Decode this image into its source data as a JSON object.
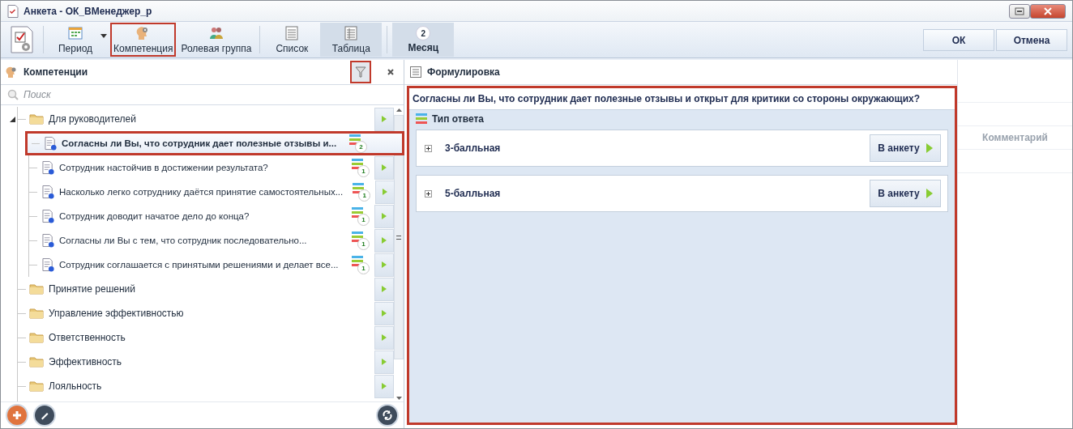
{
  "window": {
    "title": "Анкета - ОК_ВМенеджер_р"
  },
  "toolbar": {
    "items": [
      {
        "kind": "app"
      },
      {
        "kind": "dropdown",
        "label": "Период",
        "pressed": false,
        "highlighted": false
      },
      {
        "kind": "button",
        "label": "Компетенция",
        "pressed": false,
        "highlighted": true
      },
      {
        "kind": "button",
        "label": "Ролевая группа",
        "pressed": false,
        "highlighted": false
      },
      {
        "kind": "button",
        "label": "Список",
        "pressed": false,
        "highlighted": false
      },
      {
        "kind": "button",
        "label": "Таблица",
        "pressed": true,
        "highlighted": false
      },
      {
        "kind": "badge",
        "label": "Месяц",
        "badge": "2",
        "pressed": true,
        "highlighted": false
      }
    ],
    "buttons": [
      "ОК",
      "Отмена"
    ]
  },
  "left_panel": {
    "title": "Компетенции",
    "filter_highlighted": true,
    "search": {
      "placeholder": "Поиск"
    },
    "tree": [
      {
        "label": "Для руководителей",
        "children": [
          {
            "label": "Согласны ли Вы, что сотрудник дает полезные отзывы и...",
            "count": "2",
            "selected": true,
            "highlighted": true
          },
          {
            "label": "Сотрудник настойчив в достижении результата?",
            "count": "1",
            "selected": false,
            "highlighted": false
          },
          {
            "label": "Насколько легко сотруднику даётся принятие самостоятельных...",
            "count": "1",
            "selected": false,
            "highlighted": false
          },
          {
            "label": "Сотрудник доводит начатое дело до конца?",
            "count": "1",
            "selected": false,
            "highlighted": false
          },
          {
            "label": "Согласны ли Вы с тем, что сотрудник последовательно...",
            "count": "1",
            "selected": false,
            "highlighted": false
          },
          {
            "label": "Сотрудник соглашается с принятыми решениями и делает все...",
            "count": "1",
            "selected": false,
            "highlighted": false
          }
        ]
      },
      {
        "label": "Принятие решений"
      },
      {
        "label": "Управление эффективностью"
      },
      {
        "label": "Ответственность"
      },
      {
        "label": "Эффективность"
      },
      {
        "label": "Лояльность"
      }
    ]
  },
  "right_panel": {
    "title": "Формулировка",
    "highlighted": true,
    "question": "Согласны ли Вы, что сотрудник дает полезные отзывы и открыт для критики со стороны окружающих?",
    "section_title": "Тип ответа",
    "answer_types": [
      {
        "label": "3-балльная",
        "button": "В анкету"
      },
      {
        "label": "5-балльная",
        "button": "В анкету"
      }
    ]
  },
  "background_table": {
    "column": "Комментарий"
  }
}
